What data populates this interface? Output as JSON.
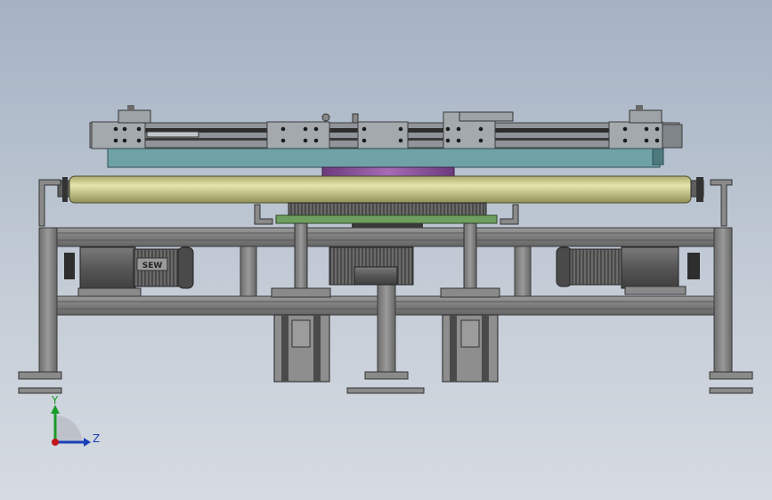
{
  "viewport": {
    "background_top": "#a4b2c3",
    "background_bottom": "#d6dbe2"
  },
  "model": {
    "motor_brand_label": "SEW"
  },
  "triad": {
    "y_label": "Y",
    "z_label": "Z",
    "y_color": "#1a9b2a",
    "z_color": "#1a3fb8",
    "origin_color": "#c01818"
  },
  "colors": {
    "frame": "#7d7d7d",
    "frame_dark": "#4e4e4e",
    "roller": "#c9cc8c",
    "teal_plate": "#6fa2a6",
    "purple_hub": "#8b4f9b",
    "green_plate": "#6e9f5f",
    "motor": "#5d5d5d"
  }
}
